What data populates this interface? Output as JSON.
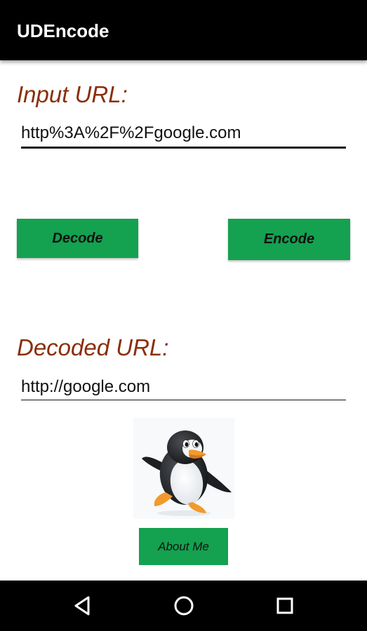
{
  "app": {
    "title": "UDEncode"
  },
  "input": {
    "label": "Input URL:",
    "value": "http%3A%2F%2Fgoogle.com"
  },
  "actions": {
    "decode_label": "Decode",
    "encode_label": "Encode"
  },
  "output": {
    "label": "Decoded URL:",
    "value": "http://google.com"
  },
  "about": {
    "label": "About Me",
    "image_icon": "penguin-icon"
  },
  "navigation": {
    "back_icon": "back-triangle-icon",
    "home_icon": "home-circle-icon",
    "recents_icon": "recents-square-icon"
  },
  "colors": {
    "app_bar": "#000000",
    "label_text": "#8a2f0a",
    "button_green": "#14a150",
    "nav_bar": "#000000"
  }
}
